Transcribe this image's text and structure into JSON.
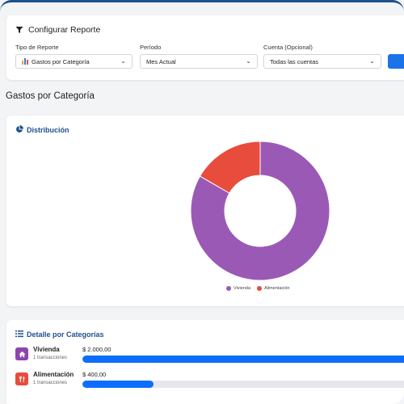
{
  "config": {
    "title": "Configurar Reporte",
    "report_type": {
      "label": "Tipo de Reporte",
      "value": "Gastos por Categoría"
    },
    "period": {
      "label": "Período",
      "value": "Mes Actual"
    },
    "account": {
      "label": "Cuenta (Opcional)",
      "value": "Todas las cuentas"
    }
  },
  "section_title": "Gastos por Categoría",
  "distribution": {
    "title": "Distribución",
    "chart_data": {
      "type": "pie",
      "categories": [
        "Vivienda",
        "Alimentación"
      ],
      "values": [
        2000,
        400
      ],
      "colors": [
        "#9b59b6",
        "#e74c3c"
      ]
    }
  },
  "detail": {
    "title": "Detalle por Categorías",
    "items": [
      {
        "name": "Vivienda",
        "count": "1 transacciones",
        "amount": "$ 2.000,00",
        "fraction": 1.0,
        "color": "#8e44ad",
        "icon": "home-icon"
      },
      {
        "name": "Alimentación",
        "count": "1 transacciones",
        "amount": "$ 400,00",
        "fraction": 0.2,
        "color": "#e74c3c",
        "icon": "utensils-icon"
      }
    ]
  }
}
